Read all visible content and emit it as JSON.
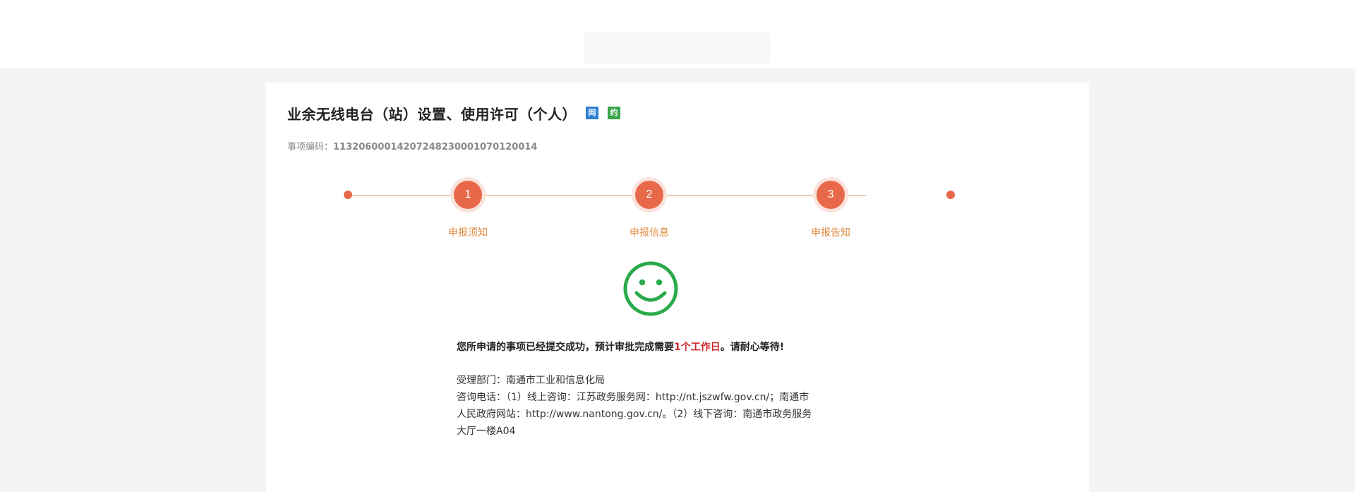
{
  "colors": {
    "accent": "#e8694a",
    "step_label": "#e08a3c",
    "line": "#e0a45e",
    "success": "#2aaa4a",
    "highlight": "#cc2a2a",
    "badge_online": "#2d7fd3",
    "badge_appoint": "#3aa54a"
  },
  "header": {
    "title": "业余无线电台（站）设置、使用许可（个人）",
    "badges": [
      {
        "text": "网",
        "icon": "online-badge-icon"
      },
      {
        "text": "约",
        "icon": "appointment-badge-icon"
      }
    ],
    "code_label": "事项编码：",
    "code_value": "11320600014207248230001070120014"
  },
  "steps": [
    {
      "number": "1",
      "label": "申报须知"
    },
    {
      "number": "2",
      "label": "申报信息"
    },
    {
      "number": "3",
      "label": "申报告知"
    }
  ],
  "result": {
    "icon": "smiley-icon",
    "message_prefix": "您所申请的事项已经提交成功，预计审批完成需要",
    "message_highlight": "1个工作日",
    "message_suffix": "。请耐心等待!",
    "department": "受理部门：南通市工业和信息化局",
    "consult_line1": "咨询电话：（1）线上咨询：江苏政务服务网：http://nt.jszwfw.gov.cn/；南通市",
    "consult_line2": "人民政府网站：http://www.nantong.gov.cn/。（2）线下咨询：南通市政务服务",
    "consult_line3": "大厅一楼A04"
  }
}
